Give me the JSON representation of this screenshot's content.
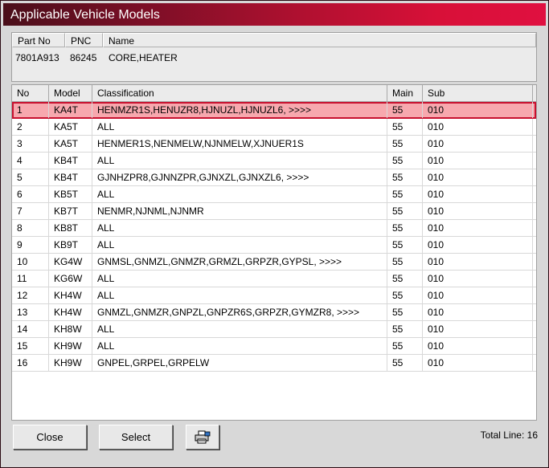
{
  "window": {
    "title": "Applicable Vehicle Models"
  },
  "part": {
    "headers": {
      "part_no": "Part No",
      "pnc": "PNC",
      "name": "Name"
    },
    "values": {
      "part_no": "7801A913",
      "pnc": "86245",
      "name": "CORE,HEATER"
    }
  },
  "grid": {
    "headers": {
      "no": "No",
      "model": "Model",
      "classification": "Classification",
      "main": "Main",
      "sub": "Sub"
    },
    "selected_row": 0,
    "rows": [
      {
        "no": "1",
        "model": "KA4T",
        "classification": "HENMZR1S,HENUZR8,HJNUZL,HJNUZL6,  >>>>",
        "main": "55",
        "sub": "010"
      },
      {
        "no": "2",
        "model": "KA5T",
        "classification": "ALL",
        "main": "55",
        "sub": "010"
      },
      {
        "no": "3",
        "model": "KA5T",
        "classification": "HENMER1S,NENMELW,NJNMELW,XJNUER1S",
        "main": "55",
        "sub": "010"
      },
      {
        "no": "4",
        "model": "KB4T",
        "classification": "ALL",
        "main": "55",
        "sub": "010"
      },
      {
        "no": "5",
        "model": "KB4T",
        "classification": "GJNHZPR8,GJNNZPR,GJNXZL,GJNXZL6,  >>>>",
        "main": "55",
        "sub": "010"
      },
      {
        "no": "6",
        "model": "KB5T",
        "classification": "ALL",
        "main": "55",
        "sub": "010"
      },
      {
        "no": "7",
        "model": "KB7T",
        "classification": "NENMR,NJNML,NJNMR",
        "main": "55",
        "sub": "010"
      },
      {
        "no": "8",
        "model": "KB8T",
        "classification": "ALL",
        "main": "55",
        "sub": "010"
      },
      {
        "no": "9",
        "model": "KB9T",
        "classification": "ALL",
        "main": "55",
        "sub": "010"
      },
      {
        "no": "10",
        "model": "KG4W",
        "classification": "GNMSL,GNMZL,GNMZR,GRMZL,GRPZR,GYPSL,  >>>>",
        "main": "55",
        "sub": "010"
      },
      {
        "no": "11",
        "model": "KG6W",
        "classification": "ALL",
        "main": "55",
        "sub": "010"
      },
      {
        "no": "12",
        "model": "KH4W",
        "classification": "ALL",
        "main": "55",
        "sub": "010"
      },
      {
        "no": "13",
        "model": "KH4W",
        "classification": "GNMZL,GNMZR,GNPZL,GNPZR6S,GRPZR,GYMZR8,  >>>>",
        "main": "55",
        "sub": "010"
      },
      {
        "no": "14",
        "model": "KH8W",
        "classification": "ALL",
        "main": "55",
        "sub": "010"
      },
      {
        "no": "15",
        "model": "KH9W",
        "classification": "ALL",
        "main": "55",
        "sub": "010"
      },
      {
        "no": "16",
        "model": "KH9W",
        "classification": "GNPEL,GRPEL,GRPELW",
        "main": "55",
        "sub": "010"
      }
    ]
  },
  "buttons": {
    "close_label": "Close",
    "select_label": "Select",
    "print_icon": "printer-icon"
  },
  "footer": {
    "total_line": "Total Line: 16"
  },
  "colors": {
    "title_gradient_start": "#4a0f1a",
    "title_gradient_end": "#e01040",
    "selected_row_fill": "#f7a8ae",
    "selected_row_border": "#c8102e"
  }
}
